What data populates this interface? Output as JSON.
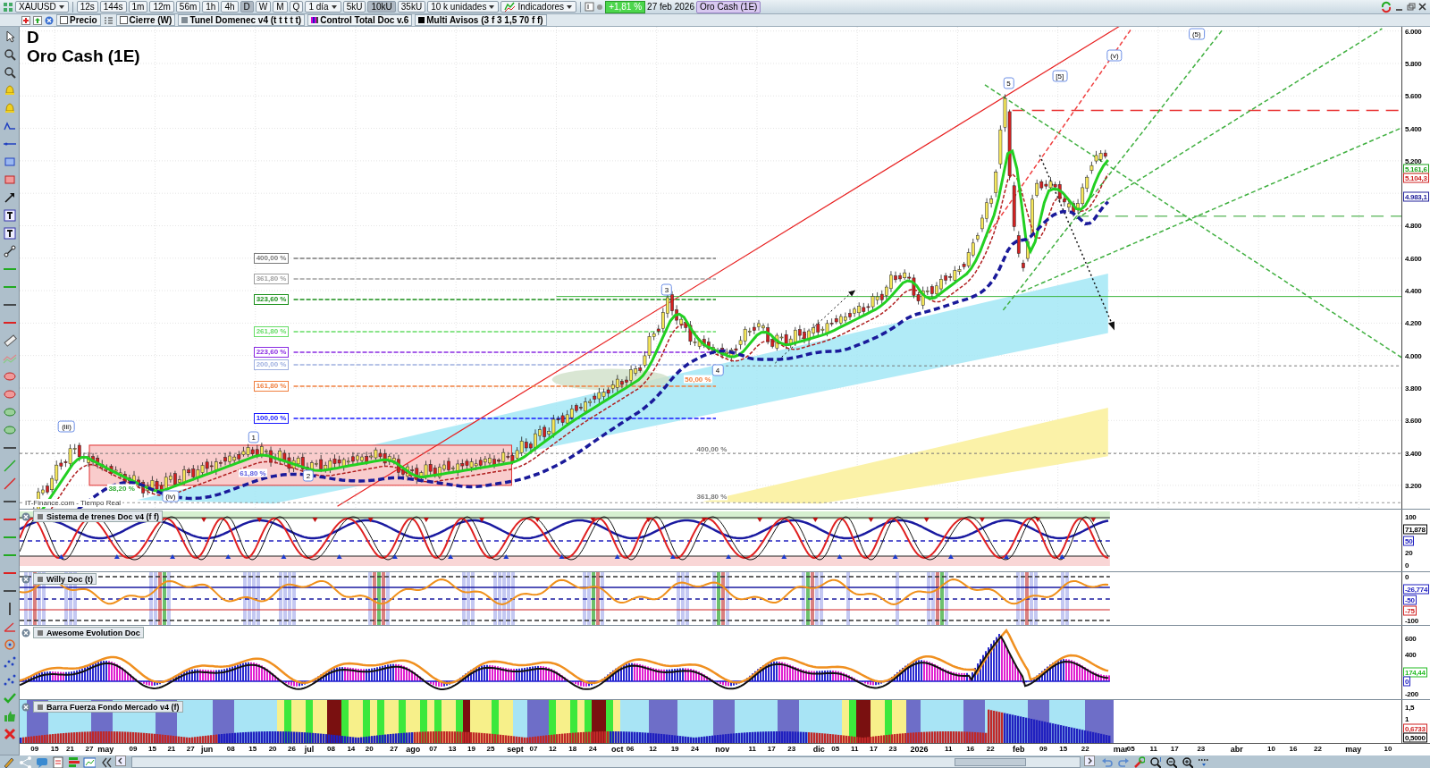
{
  "toolbar": {
    "symbol": "XAUUSD",
    "timeframes": [
      {
        "label": "12s",
        "selected": false
      },
      {
        "label": "144s",
        "selected": false
      },
      {
        "label": "1m",
        "selected": false
      },
      {
        "label": "12m",
        "selected": false
      },
      {
        "label": "56m",
        "selected": false
      },
      {
        "label": "1h",
        "selected": false
      },
      {
        "label": "4h",
        "selected": false
      },
      {
        "label": "D",
        "selected": true
      },
      {
        "label": "W",
        "selected": false
      },
      {
        "label": "M",
        "selected": false
      },
      {
        "label": "Q",
        "selected": false
      }
    ],
    "period": "1 día",
    "units": [
      {
        "label": "5kU",
        "selected": false
      },
      {
        "label": "10kU",
        "selected": true
      },
      {
        "label": "35kU",
        "selected": false
      }
    ],
    "units_menu": "10 k unidades",
    "indicators": "Indicadores",
    "change": "+1,81 %",
    "date": "27 feb 2026",
    "chart_name": "Oro Cash (1E)"
  },
  "legend": [
    {
      "label": "Precio",
      "kind": "checkbox",
      "checked": false
    },
    {
      "label": "Cierre (W)",
      "kind": "checkbox",
      "checked": false
    },
    {
      "label": "Tunel Domenec v4 (t t t t t)",
      "kind": "swatch",
      "color": "#808b94"
    },
    {
      "label": "Control Total Doc v.6",
      "kind": "striped"
    },
    {
      "label": "Multi Avisos (3 f 3 1,5 70 f f)",
      "kind": "swatch",
      "color": "#000000"
    }
  ],
  "chart": {
    "timeframe": "D",
    "title": "Oro Cash (1E)",
    "source": "IT-Finance.com - Tiempo Real",
    "fib_levels": [
      {
        "label": "400,00 %",
        "color": "#7a7a7a"
      },
      {
        "label": "361,80 %",
        "color": "#a0a0a0"
      },
      {
        "label": "323,60 %",
        "color": "#1a8f1a"
      },
      {
        "label": "261,80 %",
        "color": "#66dd66"
      },
      {
        "label": "223,60 %",
        "color": "#8a2be2"
      },
      {
        "label": "200,00 %",
        "color": "#9fb0e0"
      },
      {
        "label": "161,80 %",
        "color": "#f08040"
      },
      {
        "label": "100,00 %",
        "color": "#1a1aff"
      }
    ],
    "notes": [
      {
        "label": "400,00 %",
        "color": "#7a7a7a"
      },
      {
        "label": "361,80 %",
        "color": "#7a7a7a"
      },
      {
        "label": "61,80 %",
        "color": "#5a5adf"
      },
      {
        "label": "38,20 %",
        "color": "#33aa33"
      },
      {
        "label": "50,00 %",
        "color": "#f08040"
      }
    ],
    "waves": [
      "(iii)",
      "(iv)",
      "1",
      "2",
      "3",
      "4",
      "5",
      "[5]",
      "(v)",
      "(5)"
    ],
    "price_axis": [
      "6.000",
      "5.800",
      "5.600",
      "5.400",
      "5.200",
      "4.800",
      "4.600",
      "4.400",
      "4.200",
      "4.000",
      "3.800",
      "3.600",
      "3.400",
      "3.200"
    ],
    "price_tags": [
      {
        "text": "5.161,6",
        "color": "#1aa01a"
      },
      {
        "text": "5.104,3",
        "color": "#d02020"
      },
      {
        "text": "4.983,1",
        "color": "#20209a"
      }
    ]
  },
  "panels": [
    {
      "title": "Sistema de trenes Doc v4 (f f)",
      "kind": "trains",
      "axis": [
        {
          "text": "100",
          "kind": "tick"
        },
        {
          "text": "71,878",
          "kind": "tag",
          "color": "#000000"
        },
        {
          "text": "50",
          "kind": "tag",
          "color": "#2020c0"
        },
        {
          "text": "20",
          "kind": "tick"
        },
        {
          "text": "0",
          "kind": "tick"
        }
      ]
    },
    {
      "title": "Willy Doc (t)",
      "kind": "willy",
      "axis": [
        {
          "text": "0",
          "kind": "tick"
        },
        {
          "text": "-26,774",
          "kind": "tag",
          "color": "#2020c0"
        },
        {
          "text": "-50",
          "kind": "tag",
          "color": "#2020c0"
        },
        {
          "text": "-75",
          "kind": "tag",
          "color": "#d02020"
        },
        {
          "text": "-100",
          "kind": "tick"
        }
      ]
    },
    {
      "title": "Awesome Evolution Doc",
      "kind": "awesome",
      "axis": [
        {
          "text": "600",
          "kind": "tick"
        },
        {
          "text": "400",
          "kind": "tick"
        },
        {
          "text": "174,44",
          "kind": "tag",
          "color": "#22bb22"
        },
        {
          "text": "0",
          "kind": "tag",
          "color": "#2020c0"
        },
        {
          "text": "-200",
          "kind": "tick"
        }
      ]
    },
    {
      "title": "Barra Fuerza Fondo Mercado v4 (f)",
      "kind": "force",
      "axis": [
        {
          "text": "1,5",
          "kind": "tick"
        },
        {
          "text": "1",
          "kind": "tick"
        },
        {
          "text": "0,6733",
          "kind": "tag",
          "color": "#d02020"
        },
        {
          "text": "0,5000",
          "kind": "tag",
          "color": "#000000"
        }
      ]
    }
  ],
  "dates": [
    {
      "text": "09",
      "kind": "day"
    },
    {
      "text": "15",
      "kind": "day"
    },
    {
      "text": "21",
      "kind": "day"
    },
    {
      "text": "27",
      "kind": "day"
    },
    {
      "text": "may",
      "kind": "month"
    },
    {
      "text": "09",
      "kind": "day"
    },
    {
      "text": "15",
      "kind": "day"
    },
    {
      "text": "21",
      "kind": "day"
    },
    {
      "text": "27",
      "kind": "day"
    },
    {
      "text": "jun",
      "kind": "month"
    },
    {
      "text": "08",
      "kind": "day"
    },
    {
      "text": "15",
      "kind": "day"
    },
    {
      "text": "20",
      "kind": "day"
    },
    {
      "text": "26",
      "kind": "day"
    },
    {
      "text": "jul",
      "kind": "month"
    },
    {
      "text": "08",
      "kind": "day"
    },
    {
      "text": "14",
      "kind": "day"
    },
    {
      "text": "20",
      "kind": "day"
    },
    {
      "text": "27",
      "kind": "day"
    },
    {
      "text": "ago",
      "kind": "month"
    },
    {
      "text": "07",
      "kind": "day"
    },
    {
      "text": "13",
      "kind": "day"
    },
    {
      "text": "19",
      "kind": "day"
    },
    {
      "text": "25",
      "kind": "day"
    },
    {
      "text": "sept",
      "kind": "month"
    },
    {
      "text": "07",
      "kind": "day"
    },
    {
      "text": "12",
      "kind": "day"
    },
    {
      "text": "18",
      "kind": "day"
    },
    {
      "text": "24",
      "kind": "day"
    },
    {
      "text": "oct",
      "kind": "month"
    },
    {
      "text": "06",
      "kind": "day"
    },
    {
      "text": "12",
      "kind": "day"
    },
    {
      "text": "19",
      "kind": "day"
    },
    {
      "text": "24",
      "kind": "day"
    },
    {
      "text": "nov",
      "kind": "month"
    },
    {
      "text": "11",
      "kind": "day"
    },
    {
      "text": "17",
      "kind": "day"
    },
    {
      "text": "23",
      "kind": "day"
    },
    {
      "text": "dic",
      "kind": "month"
    },
    {
      "text": "05",
      "kind": "day"
    },
    {
      "text": "11",
      "kind": "day"
    },
    {
      "text": "17",
      "kind": "day"
    },
    {
      "text": "23",
      "kind": "day"
    },
    {
      "text": "2026",
      "kind": "month"
    },
    {
      "text": "11",
      "kind": "day"
    },
    {
      "text": "16",
      "kind": "day"
    },
    {
      "text": "22",
      "kind": "day"
    },
    {
      "text": "feb",
      "kind": "month"
    },
    {
      "text": "09",
      "kind": "day"
    },
    {
      "text": "15",
      "kind": "day"
    },
    {
      "text": "22",
      "kind": "day"
    },
    {
      "text": "mar",
      "kind": "month"
    },
    {
      "text": "05",
      "kind": "day"
    },
    {
      "text": "11",
      "kind": "day"
    },
    {
      "text": "17",
      "kind": "day"
    },
    {
      "text": "23",
      "kind": "day"
    },
    {
      "text": "abr",
      "kind": "month"
    },
    {
      "text": "10",
      "kind": "day"
    },
    {
      "text": "16",
      "kind": "day"
    },
    {
      "text": "22",
      "kind": "day"
    },
    {
      "text": "may",
      "kind": "month"
    },
    {
      "text": "10",
      "kind": "day"
    }
  ]
}
